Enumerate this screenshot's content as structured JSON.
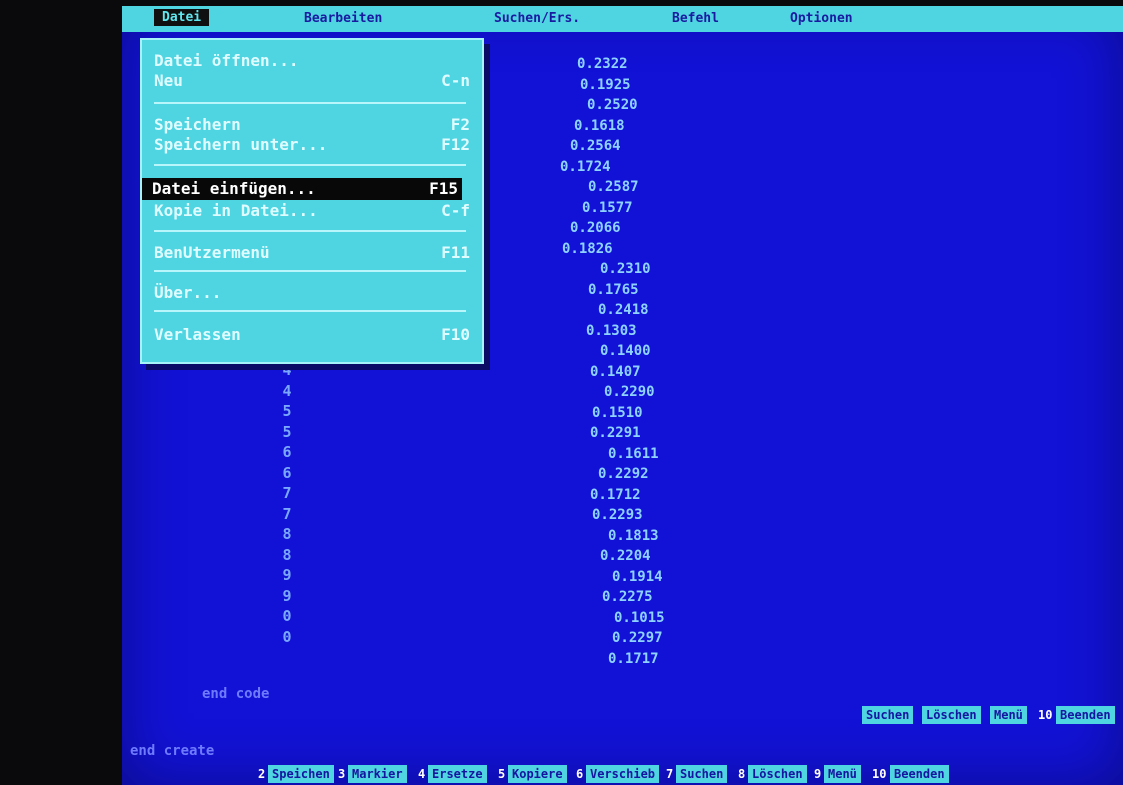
{
  "menubar": {
    "items": [
      "Datei",
      "Bearbeiten",
      "Suchen/Ers.",
      "Befehl",
      "Optionen"
    ]
  },
  "file_menu": {
    "items": [
      {
        "label": "Datei öffnen...",
        "key": ""
      },
      {
        "label": "Neu",
        "key": "C-n"
      },
      {
        "label": "Speichern",
        "key": "F2"
      },
      {
        "label": "Speichern unter...",
        "key": "F12"
      },
      {
        "label": "Datei einfügen...",
        "key": "F15"
      },
      {
        "label": "Kopie in Datei...",
        "key": "C-f"
      },
      {
        "label": "BenUtzermenü",
        "key": "F11"
      },
      {
        "label": "Über...",
        "key": ""
      },
      {
        "label": "Verlassen",
        "key": "F10"
      }
    ]
  },
  "code_right": [
    "0.2322",
    "0.1925",
    "0.2520",
    "0.1618",
    "0.2564",
    "0.1724",
    "0.2587",
    "0.1577",
    "0.2066",
    "0.1826",
    "0.2310",
    "0.1765",
    "0.2418",
    "0.1303",
    "0.1400",
    "0.1407",
    "0.2290",
    "0.1510",
    "0.2291",
    "0.1611",
    "0.2292",
    "0.1712",
    "0.2293",
    "0.1813",
    "0.2204",
    "0.1914",
    "0.2275",
    "0.1015",
    "0.2297",
    "0.1717"
  ],
  "code_left": [
    "4",
    "4",
    "5",
    "5",
    "6",
    "6",
    "7",
    "7",
    "8",
    "8",
    "9",
    "9",
    "0",
    "0"
  ],
  "end_code_text": "end code",
  "status_text": "end create",
  "fkeys_bottom": [
    {
      "num": "2",
      "label": "Speichen"
    },
    {
      "num": "3",
      "label": "Markier"
    },
    {
      "num": "4",
      "label": "Ersetze"
    },
    {
      "num": "5",
      "label": "Kopiere"
    },
    {
      "num": "6",
      "label": "Verschieb"
    },
    {
      "num": "7",
      "label": "Suchen"
    },
    {
      "num": "8",
      "label": "Löschen"
    },
    {
      "num": "9",
      "label": "Menü"
    },
    {
      "num": "10",
      "label": "Beenden"
    }
  ],
  "colors": {
    "screen_bg": "#1212d6",
    "menu_bg": "#4fd4e2",
    "menu_text": "#dffcff",
    "highlight_bg": "#080808",
    "code_text": "#8ed3ff"
  }
}
